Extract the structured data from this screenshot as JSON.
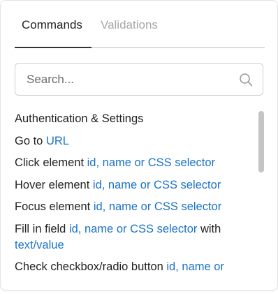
{
  "tabs": [
    {
      "label": "Commands",
      "active": true
    },
    {
      "label": "Validations",
      "active": false
    }
  ],
  "search": {
    "placeholder": "Search...",
    "value": "",
    "icon": "search-icon"
  },
  "colors": {
    "argument": "#1a73c8",
    "text": "#222222",
    "inactive_tab": "#a8a8a8",
    "active_indicator": "#333333"
  },
  "commands": [
    {
      "label": "Authentication & Settings"
    },
    {
      "label": "Go to",
      "arg": "URL"
    },
    {
      "label": "Click element",
      "arg": "id, name or CSS selector"
    },
    {
      "label": "Hover element",
      "arg": "id, name or CSS selector"
    },
    {
      "label": "Focus element",
      "arg": "id, name or CSS selector"
    },
    {
      "label": "Fill in field",
      "arg": "id, name or CSS selector",
      "middle": "with",
      "arg2": "text/value"
    },
    {
      "label": "Check checkbox/radio button",
      "arg": "id, name or"
    }
  ]
}
